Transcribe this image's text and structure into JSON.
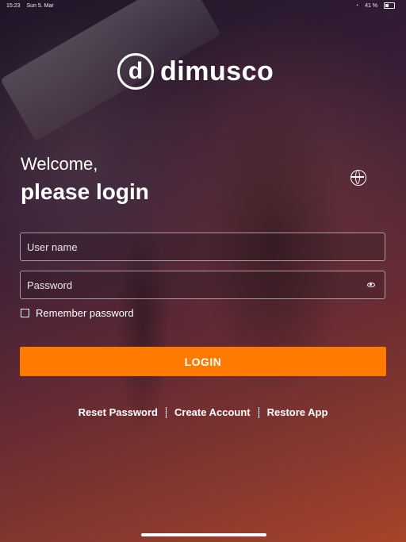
{
  "status_bar": {
    "time": "15:23",
    "date": "Sun 5. Mar",
    "battery": "41 %"
  },
  "brand": {
    "mark": "d",
    "name": "dimusco"
  },
  "login": {
    "welcome": "Welcome,",
    "prompt": "please login",
    "username_placeholder": "User name",
    "password_placeholder": "Password",
    "remember_label": "Remember password",
    "login_button": "LOGIN"
  },
  "links": {
    "reset_password": "Reset Password",
    "create_account": "Create Account",
    "restore_app": "Restore App"
  },
  "colors": {
    "accent": "#ff7b00"
  },
  "icons": {
    "language": "globe-icon",
    "show_password": "eye-icon"
  }
}
